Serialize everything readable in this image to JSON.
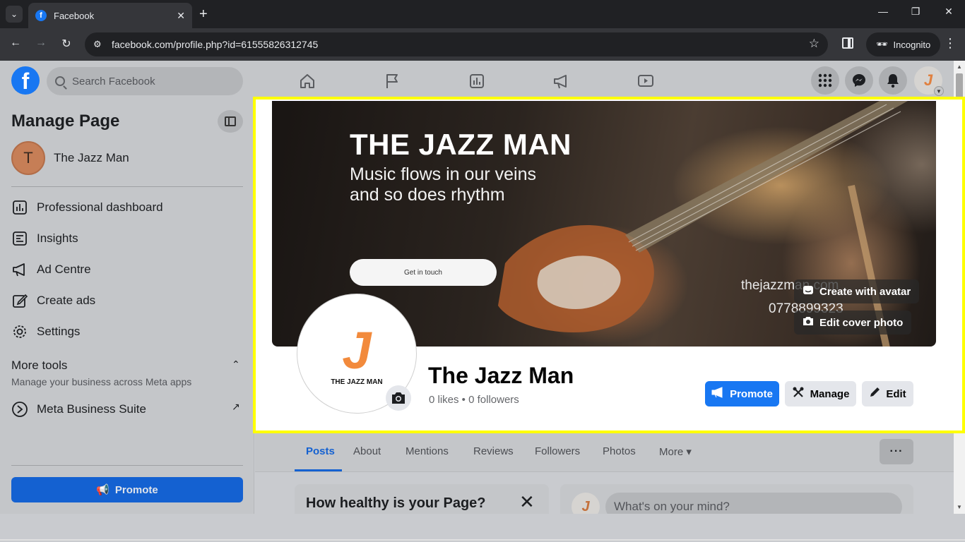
{
  "browser": {
    "tab_title": "Facebook",
    "url": "facebook.com/profile.php?id=61555826312745",
    "incognito_label": "Incognito"
  },
  "header": {
    "search_placeholder": "Search Facebook",
    "nav_icons": [
      "home-icon",
      "pages-flag-icon",
      "insights-icon",
      "ad-centre-icon",
      "video-icon"
    ],
    "right_icons": [
      "menu-grid-icon",
      "messenger-icon",
      "notifications-icon"
    ],
    "avatar_letter": "J"
  },
  "sidebar": {
    "title": "Manage Page",
    "page_initial": "T",
    "page_name": "The Jazz Man",
    "items": [
      {
        "label": "Professional dashboard",
        "icon": "dashboard-icon"
      },
      {
        "label": "Insights",
        "icon": "insights-icon"
      },
      {
        "label": "Ad Centre",
        "icon": "megaphone-icon"
      },
      {
        "label": "Create ads",
        "icon": "pencil-icon"
      },
      {
        "label": "Settings",
        "icon": "gear-icon"
      }
    ],
    "more_tools_label": "More tools",
    "more_tools_sub": "Manage your business across Meta apps",
    "meta_suite_label": "Meta Business Suite",
    "promote_label": "Promote"
  },
  "cover": {
    "title": "THE JAZZ MAN",
    "tagline_1": "Music flows in our veins",
    "tagline_2": "and so does rhythm",
    "cta": "Get in touch",
    "site": "thejazzman.com",
    "phone": "0778899323",
    "create_avatar_label": "Create with avatar",
    "edit_cover_label": "Edit cover photo"
  },
  "profile": {
    "logo_letter": "J",
    "logo_text": "THE JAZZ MAN",
    "name": "The Jazz Man",
    "stats": "0 likes • 0 followers",
    "promote_label": "Promote",
    "manage_label": "Manage",
    "edit_label": "Edit"
  },
  "tabs": [
    {
      "label": "Posts",
      "active": true
    },
    {
      "label": "About"
    },
    {
      "label": "Mentions"
    },
    {
      "label": "Reviews"
    },
    {
      "label": "Followers"
    },
    {
      "label": "Photos"
    },
    {
      "label": "More ▾"
    }
  ],
  "more_dots": "···",
  "health_card": {
    "title": "How healthy is your Page?",
    "close": "✕"
  },
  "composer": {
    "avatar_letter": "J",
    "placeholder": "What's on your mind?"
  },
  "colors": {
    "accent": "#1877f2",
    "highlight": "#ffff00",
    "logo_orange": "#f28a3c"
  }
}
